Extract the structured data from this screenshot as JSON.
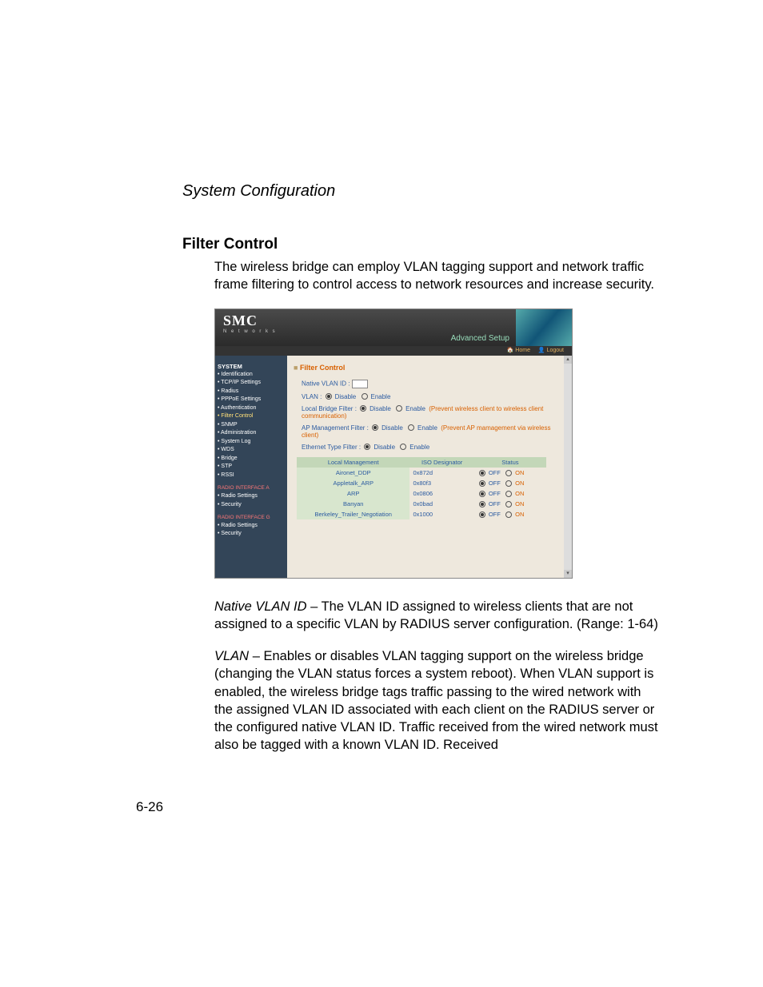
{
  "doc": {
    "chapter": "System Configuration",
    "section": "Filter Control",
    "intro": "The wireless bridge can employ VLAN tagging support and network traffic frame filtering to control access to network resources and increase security.",
    "native_vlan_term": "Native VLAN ID",
    "native_vlan_body": " – The VLAN ID assigned to wireless clients that are not assigned to a specific VLAN by RADIUS server configuration. (Range: 1-64)",
    "vlan_term": "VLAN",
    "vlan_body": " – Enables or disables VLAN tagging support on the wireless bridge (changing the VLAN status forces a system reboot). When VLAN support is enabled, the wireless bridge tags traffic passing to the wired network with the assigned VLAN ID associated with each client on the RADIUS server or the configured native VLAN ID. Traffic received from the wired network must also be tagged with a known VLAN ID. Received",
    "pagenum": "6-26"
  },
  "ss": {
    "logo": "SMC",
    "logo_sub": "N e t w o r k s",
    "adv": "Advanced Setup",
    "tb_home": "🏠 Home",
    "tb_logout": "👤 Logout",
    "side_hdr": "SYSTEM",
    "side": {
      "i0": "Identification",
      "i1": "TCP/IP Settings",
      "i2": "Radius",
      "i3": "PPPoE Settings",
      "i4": "Authentication",
      "i5": "Filter Control",
      "i6": "SNMP",
      "i7": "Administration",
      "i8": "System Log",
      "i9": "WDS",
      "i10": "Bridge",
      "i11": "STP",
      "i12": "RSSI"
    },
    "radioA": "RADIO INTERFACE A",
    "radioG": "RADIO INTERFACE G",
    "rs": "Radio Settings",
    "sec": "Security",
    "title": "Filter Control",
    "nv_lbl": "Native VLAN ID  :",
    "vlan_lbl": "VLAN  :",
    "disable": "Disable",
    "enable": "Enable",
    "lbf_lbl": "Local Bridge Filter  :",
    "lbf_note": "(Prevent wireless client to wireless client communication)",
    "apm_lbl": "AP Management Filter  :",
    "apm_note": "(Prevent AP mamagement via wireless client)",
    "etf_lbl": "Ethernet Type Filter  :",
    "th0": "Local Management",
    "th1": "ISO Designator",
    "th2": "Status",
    "off": "OFF",
    "on": "ON",
    "rows": {
      "r0n": "Aironet_DDP",
      "r0d": "0x872d",
      "r1n": "Appletalk_ARP",
      "r1d": "0x80f3",
      "r2n": "ARP",
      "r2d": "0x0806",
      "r3n": "Banyan",
      "r3d": "0x0bad",
      "r4n": "Berkeley_Trailer_Negotiation",
      "r4d": "0x1000"
    }
  }
}
